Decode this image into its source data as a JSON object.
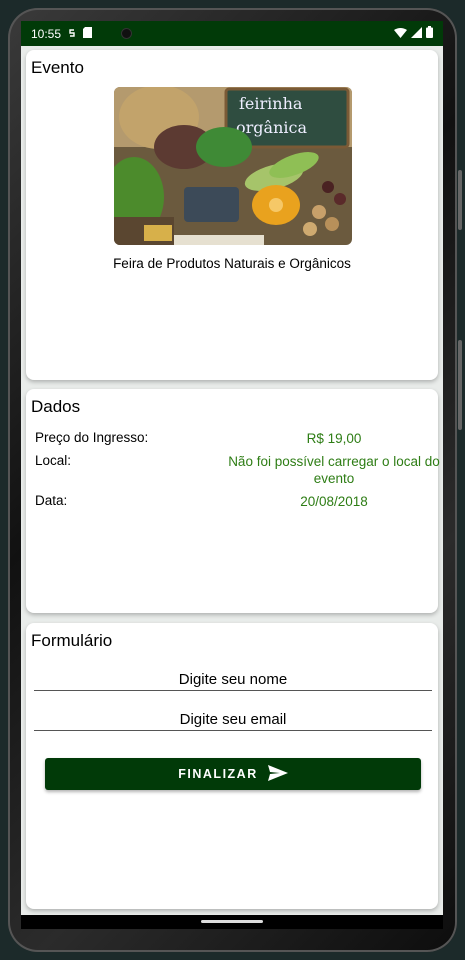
{
  "status": {
    "time": "10:55"
  },
  "evento": {
    "title": "Evento",
    "image_sign_line1": "feirinha",
    "image_sign_line2": "orgânica",
    "caption": "Feira de Produtos Naturais e Orgânicos"
  },
  "dados": {
    "title": "Dados",
    "rows": [
      {
        "label": "Preço do Ingresso:",
        "value": "R$ 19,00"
      },
      {
        "label": "Local:",
        "value": "Não foi possível carregar o local do evento"
      },
      {
        "label": "Data:",
        "value": "20/08/2018"
      }
    ]
  },
  "formulario": {
    "title": "Formulário",
    "name_placeholder": "Digite seu nome",
    "email_placeholder": "Digite seu email",
    "submit_label": "FINALIZAR"
  },
  "colors": {
    "primary": "#013a08",
    "value_text": "#2e7d15",
    "background": "#e9ecea"
  }
}
